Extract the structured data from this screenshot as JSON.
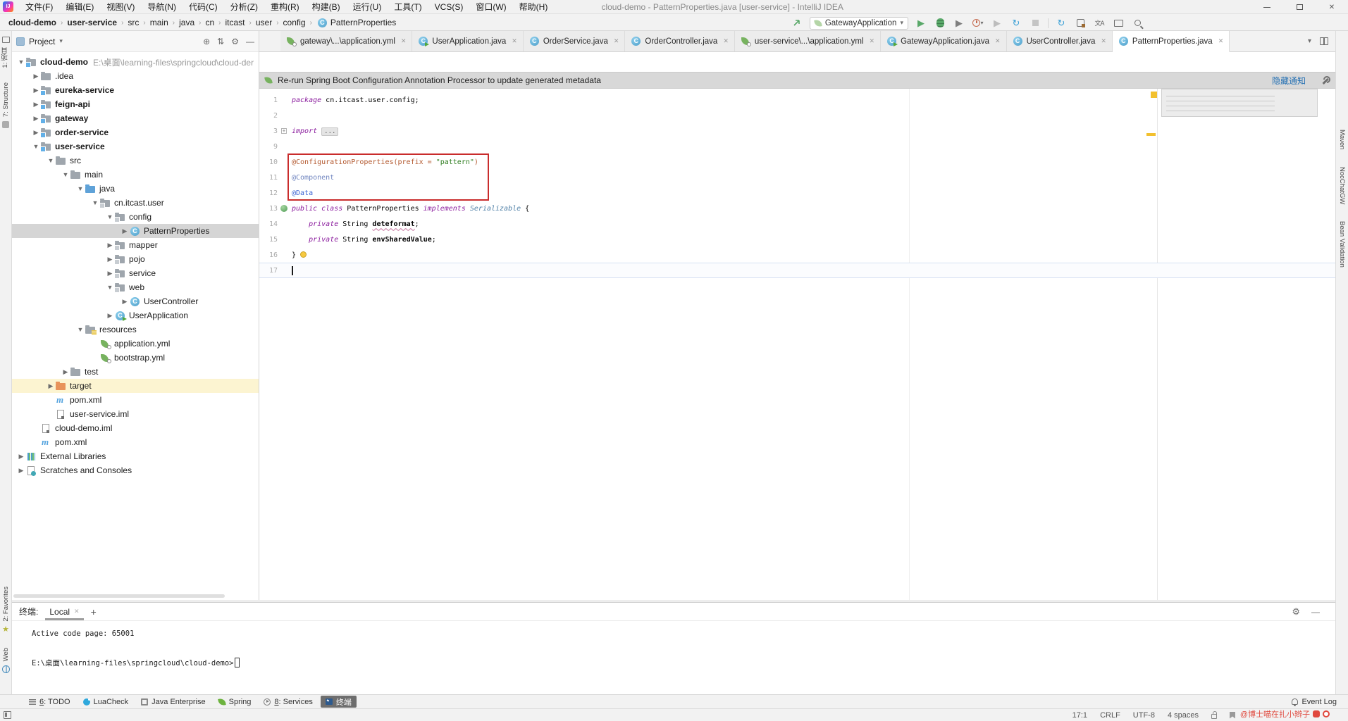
{
  "colors": {
    "accent_red_box": "#C92C2C",
    "selection_grey": "#D5D5D5",
    "highlight_yellow": "#FCF4D1",
    "watermark_red": "#E0493E",
    "run_green": "#59A869"
  },
  "title_bar": {
    "title": "cloud-demo - PatternProperties.java [user-service] - IntelliJ IDEA",
    "logo": "IJ",
    "menus": [
      "文件(F)",
      "编辑(E)",
      "视图(V)",
      "导航(N)",
      "代码(C)",
      "分析(Z)",
      "重构(R)",
      "构建(B)",
      "运行(U)",
      "工具(T)",
      "VCS(S)",
      "窗口(W)",
      "帮助(H)"
    ]
  },
  "toolbar": {
    "breadcrumbs": [
      "cloud-demo",
      "user-service",
      "src",
      "main",
      "java",
      "cn",
      "itcast",
      "user",
      "config"
    ],
    "breadcrumb_class": "PatternProperties",
    "run_config": "GatewayApplication",
    "icons": [
      "navigate-back-icon",
      "run-icon",
      "debug-icon",
      "coverage-icon",
      "profiler-icon",
      "run-disabled-icon",
      "rerun-icon",
      "stop-icon",
      "resume-icon",
      "attach-icon",
      "translate-icon",
      "presentation-icon",
      "search-icon"
    ]
  },
  "left_stripe": {
    "top": [
      {
        "label": "1: 项目",
        "icon": "project-icon"
      },
      {
        "label": "7: Structure",
        "icon": "structure-icon"
      }
    ],
    "bottom": [
      {
        "label": "2: Favorites",
        "icon": "star-icon"
      },
      {
        "label": "Web",
        "icon": "globe-icon"
      }
    ]
  },
  "right_stripe": [
    {
      "label": "Maven"
    },
    {
      "label": "NocChatGW"
    },
    {
      "label": "Bean Validation"
    }
  ],
  "project_panel": {
    "header": "Project",
    "header_icons": [
      "locate-icon",
      "collapse-all-icon",
      "settings-icon",
      "hide-icon"
    ],
    "tree": [
      {
        "label": "cloud-demo",
        "level": 0,
        "arrow": "open",
        "icon": "folder-module",
        "bold": true,
        "path": "E:\\桌面\\learning-files\\springcloud\\cloud-der"
      },
      {
        "label": ".idea",
        "level": 1,
        "arrow": "closed",
        "icon": "folder"
      },
      {
        "label": "eureka-service",
        "level": 1,
        "arrow": "closed",
        "icon": "folder-module",
        "bold": true
      },
      {
        "label": "feign-api",
        "level": 1,
        "arrow": "closed",
        "icon": "folder-module",
        "bold": true
      },
      {
        "label": "gateway",
        "level": 1,
        "arrow": "closed",
        "icon": "folder-module",
        "bold": true
      },
      {
        "label": "order-service",
        "level": 1,
        "arrow": "closed",
        "icon": "folder-module",
        "bold": true
      },
      {
        "label": "user-service",
        "level": 1,
        "arrow": "open",
        "icon": "folder-module",
        "bold": true
      },
      {
        "label": "src",
        "level": 2,
        "arrow": "open",
        "icon": "folder"
      },
      {
        "label": "main",
        "level": 3,
        "arrow": "open",
        "icon": "folder"
      },
      {
        "label": "java",
        "level": 4,
        "arrow": "open",
        "icon": "folder-java"
      },
      {
        "label": "cn.itcast.user",
        "level": 5,
        "arrow": "open",
        "icon": "package"
      },
      {
        "label": "config",
        "level": 6,
        "arrow": "open",
        "icon": "package"
      },
      {
        "label": "PatternProperties",
        "level": 7,
        "arrow": "closed",
        "icon": "class",
        "selected": true
      },
      {
        "label": "mapper",
        "level": 6,
        "arrow": "closed",
        "icon": "package"
      },
      {
        "label": "pojo",
        "level": 6,
        "arrow": "closed",
        "icon": "package"
      },
      {
        "label": "service",
        "level": 6,
        "arrow": "closed",
        "icon": "package"
      },
      {
        "label": "web",
        "level": 6,
        "arrow": "open",
        "icon": "package"
      },
      {
        "label": "UserController",
        "level": 7,
        "arrow": "closed",
        "icon": "class"
      },
      {
        "label": "UserApplication",
        "level": 6,
        "arrow": "closed",
        "icon": "boot-class"
      },
      {
        "label": "resources",
        "level": 4,
        "arrow": "open",
        "icon": "folder-resources"
      },
      {
        "label": "application.yml",
        "level": 5,
        "arrow": "none",
        "icon": "yml"
      },
      {
        "label": "bootstrap.yml",
        "level": 5,
        "arrow": "none",
        "icon": "yml"
      },
      {
        "label": "test",
        "level": 3,
        "arrow": "closed",
        "icon": "folder"
      },
      {
        "label": "target",
        "level": 2,
        "arrow": "closed",
        "icon": "folder-excluded",
        "highlight": true
      },
      {
        "label": "pom.xml",
        "level": 2,
        "arrow": "none",
        "icon": "maven"
      },
      {
        "label": "user-service.iml",
        "level": 2,
        "arrow": "none",
        "icon": "iml"
      },
      {
        "label": "cloud-demo.iml",
        "level": 1,
        "arrow": "none",
        "icon": "iml"
      },
      {
        "label": "pom.xml",
        "level": 1,
        "arrow": "none",
        "icon": "maven"
      },
      {
        "label": "External Libraries",
        "level": 0,
        "arrow": "closed",
        "icon": "extlib"
      },
      {
        "label": "Scratches and Consoles",
        "level": 0,
        "arrow": "closed",
        "icon": "scratch"
      }
    ]
  },
  "tabs": [
    {
      "label": "gateway\\...\\application.yml",
      "icon": "yml",
      "active": false
    },
    {
      "label": "UserApplication.java",
      "icon": "boot-class",
      "active": false
    },
    {
      "label": "OrderService.java",
      "icon": "class",
      "active": false
    },
    {
      "label": "OrderController.java",
      "icon": "class",
      "active": false
    },
    {
      "label": "user-service\\...\\application.yml",
      "icon": "yml",
      "active": false
    },
    {
      "label": "GatewayApplication.java",
      "icon": "boot-class",
      "active": false
    },
    {
      "label": "UserController.java",
      "icon": "class",
      "active": false
    },
    {
      "label": "PatternProperties.java",
      "icon": "class",
      "active": true
    }
  ],
  "editor": {
    "notification": {
      "icon": "spring-leaf-icon",
      "text": "Re-run Spring Boot Configuration Annotation Processor to update generated metadata",
      "action": "隐藏通知"
    },
    "lines": [
      {
        "n": "1",
        "tokens": [
          [
            "kw",
            "package"
          ],
          [
            "pln",
            " cn.itcast.user.config;"
          ]
        ]
      },
      {
        "n": "2",
        "tokens": []
      },
      {
        "n": "3",
        "tokens": [
          [
            "kw",
            "import"
          ],
          [
            "pln",
            " "
          ],
          [
            "fold",
            "..."
          ]
        ],
        "gutter": "fold"
      },
      {
        "n": "9",
        "tokens": []
      },
      {
        "n": "10",
        "tokens": [
          [
            "annA",
            "@ConfigurationProperties(prefix = "
          ],
          [
            "str",
            "\"pattern\""
          ],
          [
            "annA",
            ")"
          ]
        ]
      },
      {
        "n": "11",
        "tokens": [
          [
            "annB",
            "@Component"
          ]
        ]
      },
      {
        "n": "12",
        "tokens": [
          [
            "annC",
            "@Data"
          ]
        ]
      },
      {
        "n": "13",
        "tokens": [
          [
            "kw",
            "public class"
          ],
          [
            "pln",
            " PatternProperties "
          ],
          [
            "kw",
            "implements"
          ],
          [
            "typ",
            " Serializable "
          ],
          [
            "pln",
            "{"
          ]
        ],
        "gutter": "bean"
      },
      {
        "n": "14",
        "tokens": [
          [
            "pln",
            "    "
          ],
          [
            "kw",
            "private"
          ],
          [
            "pln",
            " String "
          ],
          [
            "fldw",
            "deteformat"
          ],
          [
            "pln",
            ";"
          ]
        ]
      },
      {
        "n": "15",
        "tokens": [
          [
            "pln",
            "    "
          ],
          [
            "kw",
            "private"
          ],
          [
            "pln",
            " String "
          ],
          [
            "fld",
            "envSharedValue"
          ],
          [
            "pln",
            ";"
          ]
        ]
      },
      {
        "n": "16",
        "tokens": [
          [
            "pln",
            "}"
          ],
          [
            "bulb",
            ""
          ]
        ]
      },
      {
        "n": "17",
        "tokens": [
          [
            "caret",
            ""
          ]
        ],
        "current": true
      }
    ]
  },
  "terminal": {
    "label": "终端:",
    "tab": "Local",
    "lines": [
      "Active code page: 65001",
      "",
      "E:\\桌面\\learning-files\\springcloud\\cloud-demo>"
    ]
  },
  "bottom_bar": {
    "items": [
      {
        "label": "6: TODO",
        "icon": "todo"
      },
      {
        "label": "LuaCheck",
        "icon": "lua"
      },
      {
        "label": "Java Enterprise",
        "icon": "jee"
      },
      {
        "label": "Spring",
        "icon": "spring"
      },
      {
        "label": "8: Services",
        "icon": "svc"
      },
      {
        "label": "终端",
        "icon": "term",
        "active": true
      }
    ],
    "event_log": "Event Log"
  },
  "status_bar": {
    "caret_position": "17:1",
    "line_separator": "CRLF",
    "encoding": "UTF-8",
    "indent": "4 spaces",
    "icons": [
      "lock-icon",
      "bookmark-icon"
    ],
    "watermark": "@博士喵在扎小辫子"
  }
}
